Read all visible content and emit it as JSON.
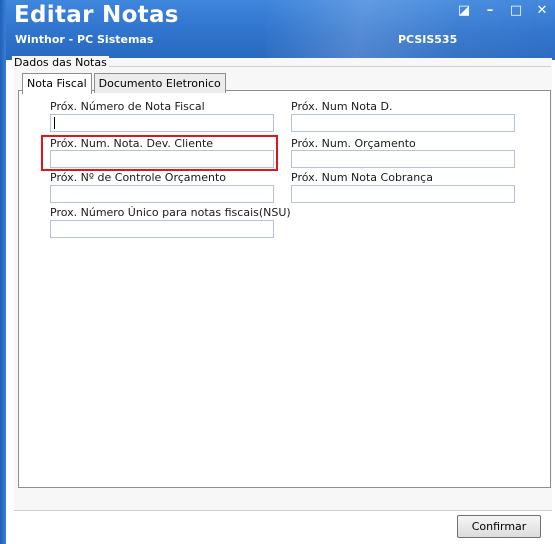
{
  "window": {
    "title": "Editar Notas",
    "subtitle": "Winthor - PC Sistemas",
    "code": "PCSIS535",
    "controls": {
      "restore": "◪",
      "minimize": "–",
      "maximize": "□",
      "close": "✕"
    }
  },
  "section": {
    "label": "Dados das Notas"
  },
  "tabs": [
    {
      "label": "Nota Fiscal",
      "active": true
    },
    {
      "label": "Documento Eletronico",
      "active": false
    }
  ],
  "fields": {
    "prox_numero_nota_fiscal": {
      "label": "Próx. Número de Nota Fiscal",
      "value": ""
    },
    "prox_num_nota_d": {
      "label": "Próx. Num Nota D.",
      "value": ""
    },
    "prox_num_nota_dev_cliente": {
      "label": "Próx. Num. Nota. Dev. Cliente",
      "value": ""
    },
    "prox_num_orcamento": {
      "label": "Próx. Num. Orçamento",
      "value": ""
    },
    "prox_controle_orcamento": {
      "label": "Próx. Nº de Controle Orçamento",
      "value": ""
    },
    "prox_num_nota_cobranca": {
      "label": "Próx. Num Nota Cobrança",
      "value": ""
    },
    "prox_numero_unico_nsu": {
      "label": "Prox. Número Único para notas fiscais(NSU)",
      "value": ""
    }
  },
  "footer": {
    "confirm_label": "Confirmar"
  },
  "colors": {
    "titlebar": "#2f73cc",
    "highlight": "#e0161d"
  }
}
